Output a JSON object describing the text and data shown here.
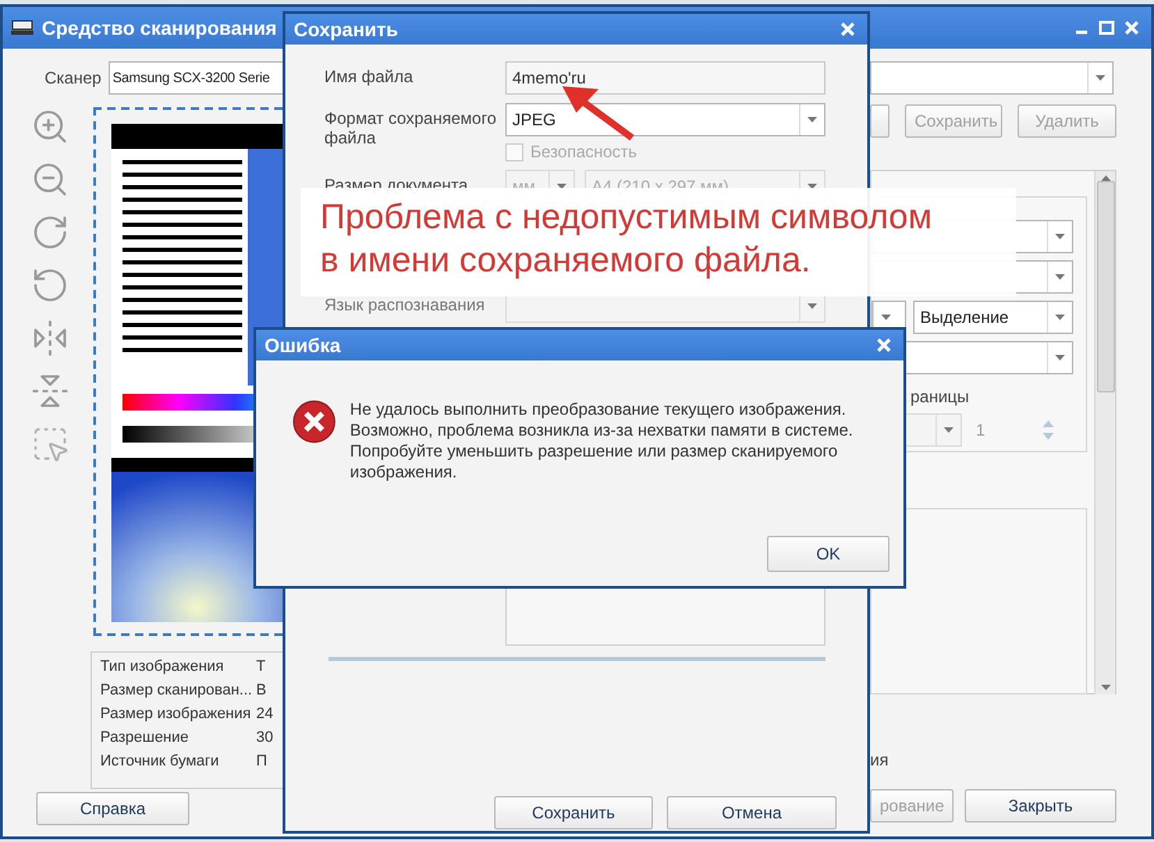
{
  "main_window": {
    "title": "Средство сканирования",
    "scanner_label": "Сканер",
    "scanner_value": "Samsung SCX-3200 Serie",
    "info_rows": [
      {
        "label": "Тип изображения",
        "value": "Т"
      },
      {
        "label": "Размер сканирован...",
        "value": "В"
      },
      {
        "label": "Размер изображения",
        "value": "24"
      },
      {
        "label": "Разрешение",
        "value": "30"
      },
      {
        "label": "Источник бумаги",
        "value": "П"
      }
    ],
    "help_button": "Справка",
    "top_buttons": [
      {
        "label": "Сохранить",
        "disabled": true
      },
      {
        "label": "Удалить",
        "disabled": true
      }
    ],
    "selection": "Выделение",
    "pages_label": "раницы",
    "page_count": "1",
    "bottom_label": "ия",
    "bottom_buttons": [
      {
        "label": "рование",
        "disabled": true
      },
      {
        "label": "Закрыть",
        "disabled": false
      }
    ]
  },
  "save_dialog": {
    "title": "Сохранить",
    "file_name": {
      "label": "Имя файла",
      "value": "4memo'ru"
    },
    "format": {
      "label": "Формат сохраняемого файла",
      "value": "JPEG"
    },
    "security": {
      "label": "Безопасность",
      "checked": false,
      "disabled": true
    },
    "doc_size": {
      "label": "Размер документа",
      "unit": "мм",
      "value": "A4 (210 x 297 мм)"
    },
    "language": {
      "label": "Язык распознавания"
    },
    "buttons": [
      "Сохранить",
      "Отмена"
    ]
  },
  "error_dialog": {
    "title": "Ошибка",
    "message": "Не удалось выполнить преобразование текущего изображения. Возможно, проблема возникла из-за нехватки памяти в системе. Попробуйте уменьшить разрешение или размер сканируемого изображения.",
    "button": "OK"
  },
  "annotation": {
    "lines": [
      "Проблема с недопустимым символом",
      "в имени сохраняемого файла."
    ]
  }
}
